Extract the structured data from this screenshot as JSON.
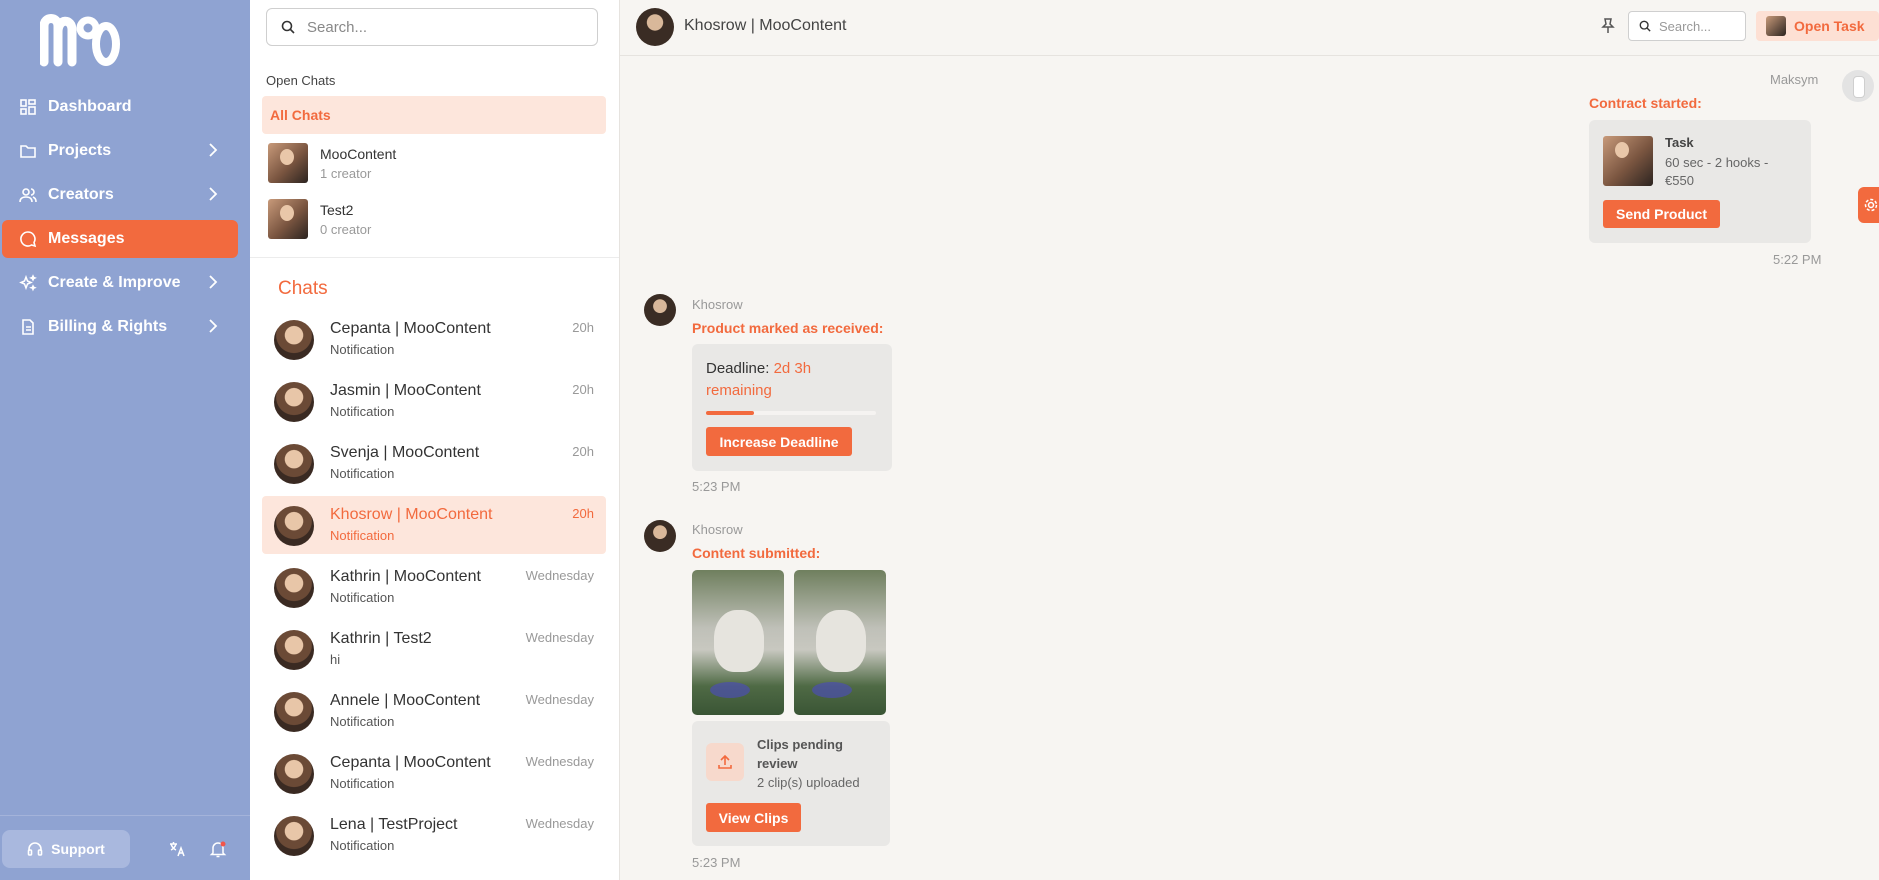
{
  "sidebar": {
    "nav": [
      {
        "label": "Dashboard",
        "icon": "dashboard-icon",
        "has_chevron": false
      },
      {
        "label": "Projects",
        "icon": "folder-icon",
        "has_chevron": true
      },
      {
        "label": "Creators",
        "icon": "users-icon",
        "has_chevron": true
      },
      {
        "label": "Messages",
        "icon": "message-icon",
        "has_chevron": false,
        "active": true
      },
      {
        "label": "Create & Improve",
        "icon": "sparkles-icon",
        "has_chevron": true
      },
      {
        "label": "Billing & Rights",
        "icon": "document-icon",
        "has_chevron": true
      }
    ],
    "support_label": "Support"
  },
  "middle": {
    "search_placeholder": "Search...",
    "open_chats_label": "Open Chats",
    "all_chats_label": "All Chats",
    "groups": [
      {
        "name": "MooContent",
        "sub": "1 creator"
      },
      {
        "name": "Test2",
        "sub": "0 creator"
      }
    ],
    "chats_heading": "Chats",
    "chats": [
      {
        "name": "Cepanta | MooContent",
        "sub": "Notification",
        "time": "20h"
      },
      {
        "name": "Jasmin | MooContent",
        "sub": "Notification",
        "time": "20h"
      },
      {
        "name": "Svenja | MooContent",
        "sub": "Notification",
        "time": "20h"
      },
      {
        "name": "Khosrow | MooContent",
        "sub": "Notification",
        "time": "20h",
        "active": true
      },
      {
        "name": "Kathrin | MooContent",
        "sub": "Notification",
        "time": "Wednesday"
      },
      {
        "name": "Kathrin | Test2",
        "sub": "hi",
        "time": "Wednesday"
      },
      {
        "name": "Annele | MooContent",
        "sub": "Notification",
        "time": "Wednesday"
      },
      {
        "name": "Cepanta | MooContent",
        "sub": "Notification",
        "time": "Wednesday"
      },
      {
        "name": "Lena | TestProject",
        "sub": "Notification",
        "time": "Wednesday"
      }
    ]
  },
  "topbar": {
    "title": "Khosrow | MooContent",
    "search_placeholder": "Search...",
    "open_task_label": "Open Task"
  },
  "messages": {
    "m1": {
      "sender": "Maksym",
      "event": "Contract started:",
      "task_title": "Task",
      "task_details": "60 sec - 2 hooks - €550",
      "button": "Send Product",
      "time": "5:22 PM"
    },
    "m2": {
      "sender": "Khosrow",
      "event": "Product marked as received:",
      "deadline_label": "Deadline:",
      "deadline_value": "2d 3h remaining",
      "deadline_progress": 0.28,
      "button": "Increase Deadline",
      "time": "5:23 PM"
    },
    "m3": {
      "sender": "Khosrow",
      "event": "Content submitted:",
      "pending_title": "Clips pending review",
      "pending_sub": "2 clip(s) uploaded",
      "button": "View Clips",
      "time": "5:23 PM"
    }
  },
  "colors": {
    "accent": "#f26a3e",
    "sidebar": "#8fa3d2",
    "active_row": "#fde6dc"
  }
}
